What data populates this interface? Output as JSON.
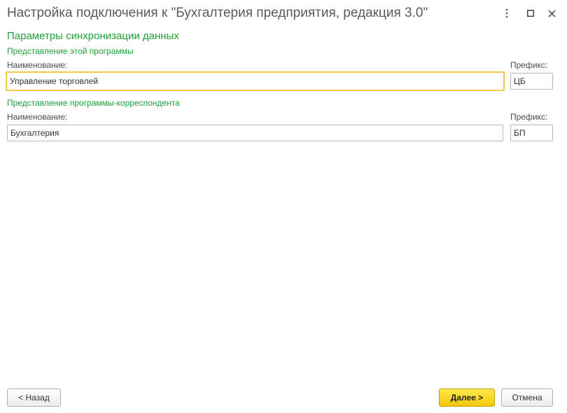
{
  "window": {
    "title": "Настройка подключения к \"Бухгалтерия предприятия, редакция 3.0\""
  },
  "section": {
    "title": "Параметры синхронизации данных"
  },
  "this_program": {
    "group_title": "Представление этой программы",
    "name_label": "Наименование:",
    "name_value": "Управление торговлей",
    "prefix_label": "Префикс:",
    "prefix_value": "ЦБ"
  },
  "correspondent": {
    "group_title": "Представление программы-корреспондента",
    "name_label": "Наименование:",
    "name_value": "Бухгалтерия",
    "prefix_label": "Префикс:",
    "prefix_value": "БП"
  },
  "footer": {
    "back_label": "< Назад",
    "next_label": "Далее >",
    "cancel_label": "Отмена"
  }
}
